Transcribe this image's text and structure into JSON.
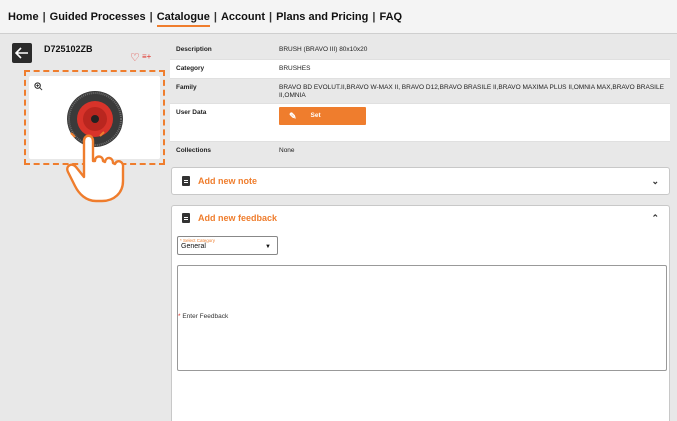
{
  "nav": {
    "items": [
      "Home",
      "Guided Processes",
      "Catalogue",
      "Account",
      "Plans and Pricing",
      "FAQ"
    ],
    "separator": "|",
    "active": "Catalogue"
  },
  "product": {
    "code": "D725102ZB",
    "back_icon": "arrow-left-icon",
    "favorite_icon": "heart-icon",
    "add_to_list_icon": "playlist-add-icon",
    "zoom_icon": "zoom-in-icon"
  },
  "details": {
    "description_label": "Description",
    "description_value": "BRUSH (BRAVO III) 80x10x20",
    "category_label": "Category",
    "category_value": "BRUSHES",
    "family_label": "Family",
    "family_value": "BRAVO BD EVOLUT.II,BRAVO W-MAX II, BRAVO D12,BRAVO BRASILE II,BRAVO MAXIMA PLUS II,OMNIA MAX,BRAVO BRASILE II,OMNIA",
    "user_data_label": "User Data",
    "set_label": "Set",
    "collections_label": "Collections",
    "collections_value": "None"
  },
  "note_panel": {
    "title": "Add new note",
    "state": "collapsed"
  },
  "feedback_panel": {
    "title": "Add new feedback",
    "state": "expanded",
    "select_label": "* Select Category",
    "select_value": "General",
    "feedback_placeholder": "Enter Feedback",
    "required_mark": "*"
  },
  "colors": {
    "accent": "#ef7d2d",
    "heart": "#e0342c",
    "background": "#e8e8e8"
  }
}
